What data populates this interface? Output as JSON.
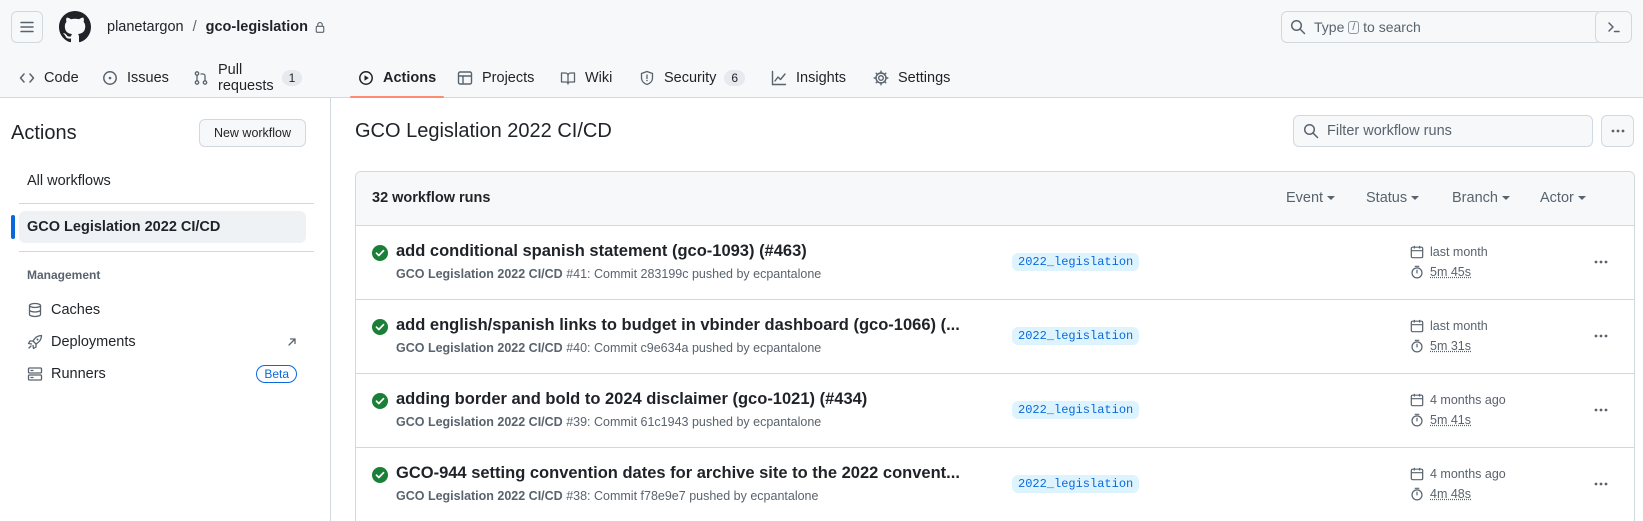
{
  "header": {
    "owner": "planetargon",
    "separator": "/",
    "repo": "gco-legislation",
    "search": {
      "prefix": "Type",
      "key": "/",
      "suffix": "to search"
    }
  },
  "tabs": [
    {
      "label": "Code",
      "icon": "code-icon"
    },
    {
      "label": "Issues",
      "icon": "issue-icon"
    },
    {
      "label": "Pull requests",
      "icon": "pull-request-icon",
      "count": "1"
    },
    {
      "label": "Actions",
      "icon": "play-icon",
      "active": true
    },
    {
      "label": "Projects",
      "icon": "table-icon"
    },
    {
      "label": "Wiki",
      "icon": "book-icon"
    },
    {
      "label": "Security",
      "icon": "shield-icon",
      "count": "6"
    },
    {
      "label": "Insights",
      "icon": "graph-icon"
    },
    {
      "label": "Settings",
      "icon": "gear-icon"
    }
  ],
  "sidebar": {
    "title": "Actions",
    "new_workflow": "New workflow",
    "all_workflows": "All workflows",
    "selected_workflow": "GCO Legislation 2022 CI/CD",
    "management_heading": "Management",
    "management": [
      {
        "label": "Caches",
        "icon": "database-icon"
      },
      {
        "label": "Deployments",
        "icon": "rocket-icon"
      },
      {
        "label": "Runners",
        "icon": "server-icon",
        "badge": "Beta"
      }
    ]
  },
  "main": {
    "title": "GCO Legislation 2022 CI/CD",
    "filter_placeholder": "Filter workflow runs",
    "runs_count": "32 workflow runs",
    "filters": [
      "Event",
      "Status",
      "Branch",
      "Actor"
    ],
    "runs": [
      {
        "title": "add conditional spanish statement (gco-1093) (#463)",
        "workflow": "GCO Legislation 2022 CI/CD",
        "detail": "#41: Commit 283199c pushed by ecpantalone",
        "branch": "2022_legislation",
        "when": "last month",
        "duration": "5m 45s",
        "status": "success"
      },
      {
        "title": "add english/spanish links to budget in vbinder dashboard (gco-1066) (...",
        "workflow": "GCO Legislation 2022 CI/CD",
        "detail": "#40: Commit c9e634a pushed by ecpantalone",
        "branch": "2022_legislation",
        "when": "last month",
        "duration": "5m 31s",
        "status": "success"
      },
      {
        "title": "adding border and bold to 2024 disclaimer (gco-1021) (#434)",
        "workflow": "GCO Legislation 2022 CI/CD",
        "detail": "#39: Commit 61c1943 pushed by ecpantalone",
        "branch": "2022_legislation",
        "when": "4 months ago",
        "duration": "5m 41s",
        "status": "success"
      },
      {
        "title": "GCO-944 setting convention dates for archive site to the 2022 convent...",
        "workflow": "GCO Legislation 2022 CI/CD",
        "detail": "#38: Commit f78e9e7 pushed by ecpantalone",
        "branch": "2022_legislation",
        "when": "4 months ago",
        "duration": "4m 48s",
        "status": "success"
      }
    ]
  },
  "colors": {
    "accent": "#0969da",
    "success": "#1a7f37",
    "tab_underline": "#fd8c73"
  }
}
